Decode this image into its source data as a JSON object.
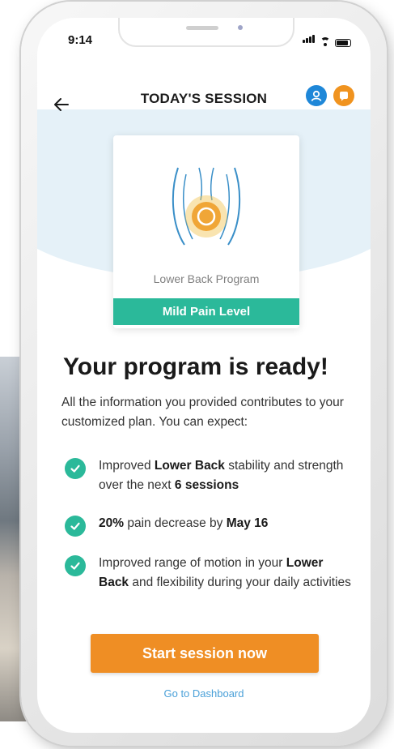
{
  "status_bar": {
    "time": "9:14"
  },
  "header": {
    "title": "TODAY'S SESSION"
  },
  "program_card": {
    "program_name": "Lower Back Program",
    "pain_level": "Mild Pain Level"
  },
  "main": {
    "headline": "Your program is ready!",
    "intro": "All the information you provided contributes to your customized plan. You can expect:"
  },
  "benefits": [
    {
      "pre": "Improved ",
      "b1": "Lower Back",
      "mid": " stability and strength over the next ",
      "b2": "6 sessions",
      "post": ""
    },
    {
      "pre": "",
      "b1": "20%",
      "mid": " pain decrease by ",
      "b2": "May 16",
      "post": ""
    },
    {
      "pre": "Improved range of motion in your ",
      "b1": "Lower Back",
      "mid": " and flexibility during your daily activities",
      "b2": "",
      "post": ""
    }
  ],
  "actions": {
    "start_label": "Start session now",
    "dashboard_label": "Go to Dashboard"
  },
  "colors": {
    "accent_green": "#2bb99a",
    "cta_orange": "#ef8e24",
    "user_icon_blue": "#1e87d8",
    "chat_icon_orange": "#f0931f",
    "link_blue": "#4aa0d8"
  },
  "icons": [
    "back-arrow-icon",
    "user-icon",
    "chat-icon",
    "lower-back-icon",
    "check-icon",
    "signal-icon",
    "wifi-icon",
    "battery-icon"
  ]
}
